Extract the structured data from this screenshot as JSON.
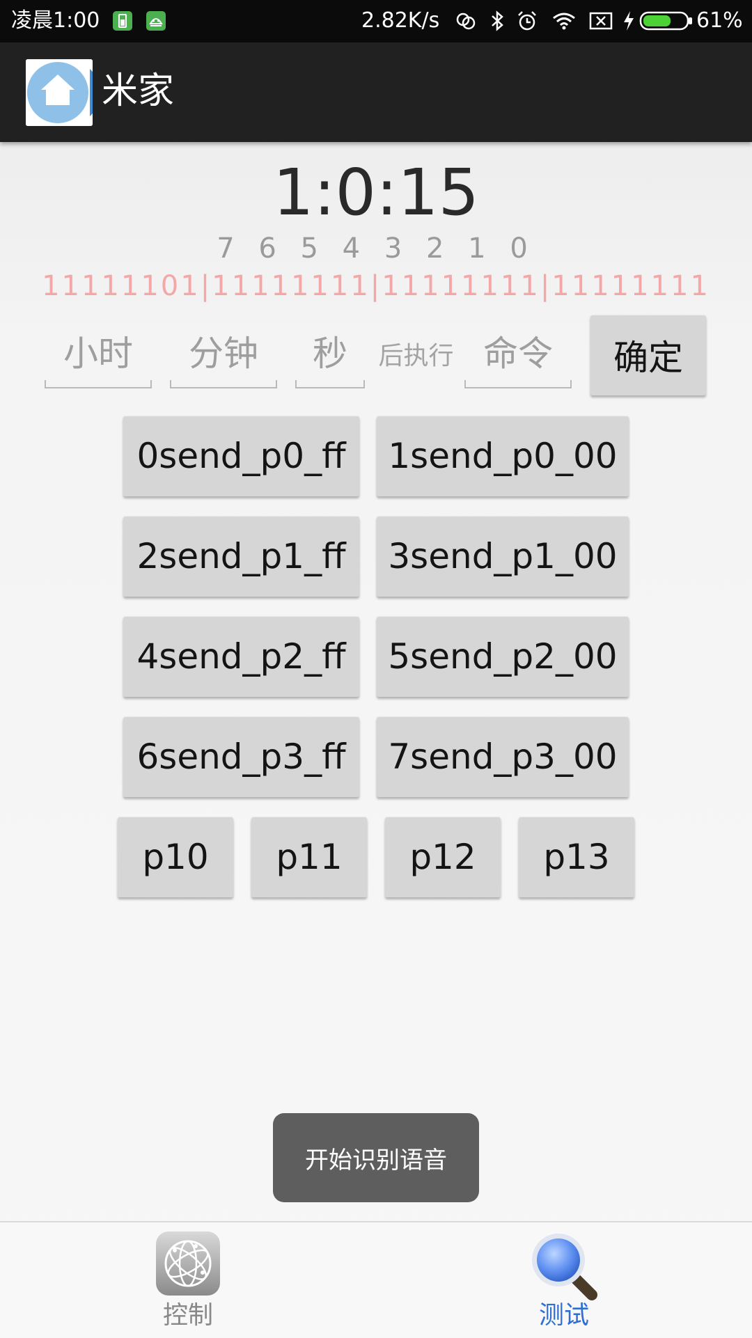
{
  "status_bar": {
    "time": "凌晨1:00",
    "net_speed": "2.82K/s",
    "battery_percent": "61%"
  },
  "app_bar": {
    "title": "米家"
  },
  "timer": {
    "display": "1:0:15"
  },
  "bits": {
    "index_label": "7 6 5 4 3 2 1 0",
    "pattern": "11111101|11111111|11111111|11111111"
  },
  "schedule": {
    "hours_placeholder": "小时",
    "minutes_placeholder": "分钟",
    "seconds_placeholder": "秒",
    "after_label": "后执行",
    "command_placeholder": "命令",
    "confirm_label": "确定"
  },
  "send_buttons": [
    "0send_p0_ff",
    "1send_p0_00",
    "2send_p1_ff",
    "3send_p1_00",
    "4send_p2_ff",
    "5send_p2_00",
    "6send_p3_ff",
    "7send_p3_00"
  ],
  "port_buttons": [
    "p10",
    "p11",
    "p12",
    "p13"
  ],
  "toast": {
    "message": "开始识别语音"
  },
  "bottom_nav": {
    "items": [
      {
        "label": "控制",
        "icon": "globe-icon",
        "color": "#888888"
      },
      {
        "label": "测试",
        "icon": "magnifier-icon",
        "color": "#2f6fd1"
      }
    ]
  }
}
